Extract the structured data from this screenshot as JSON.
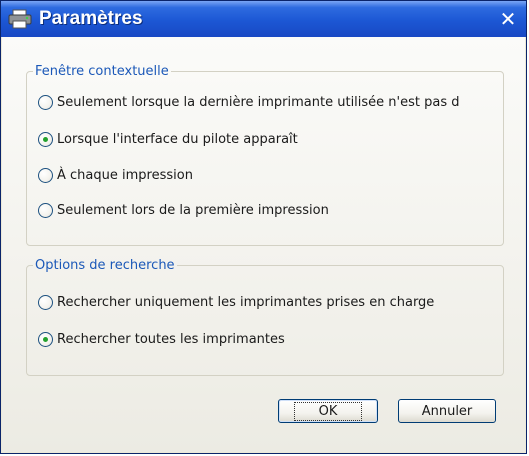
{
  "window": {
    "title": "Paramètres",
    "title_icon": "printer-settings-icon",
    "close_symbol": "✕"
  },
  "popup_group": {
    "title": "Fenêtre contextuelle",
    "options": [
      {
        "label": "Seulement lorsque la dernière imprimante utilisée n'est pas d",
        "selected": false
      },
      {
        "label": "Lorsque l'interface du pilote apparaît",
        "selected": true
      },
      {
        "label": "À chaque impression",
        "selected": false
      },
      {
        "label": "Seulement lors de la première impression",
        "selected": false
      }
    ]
  },
  "search_group": {
    "title": "Options de recherche",
    "options": [
      {
        "label": "Rechercher uniquement les imprimantes prises en charge",
        "selected": false
      },
      {
        "label": "Rechercher toutes les imprimantes",
        "selected": true
      }
    ]
  },
  "buttons": {
    "ok_label": "OK",
    "cancel_label": "Annuler"
  },
  "colors": {
    "titlebar": "#1c57d4",
    "group_title": "#1b58b8",
    "radio_selected": "#24a12d"
  }
}
